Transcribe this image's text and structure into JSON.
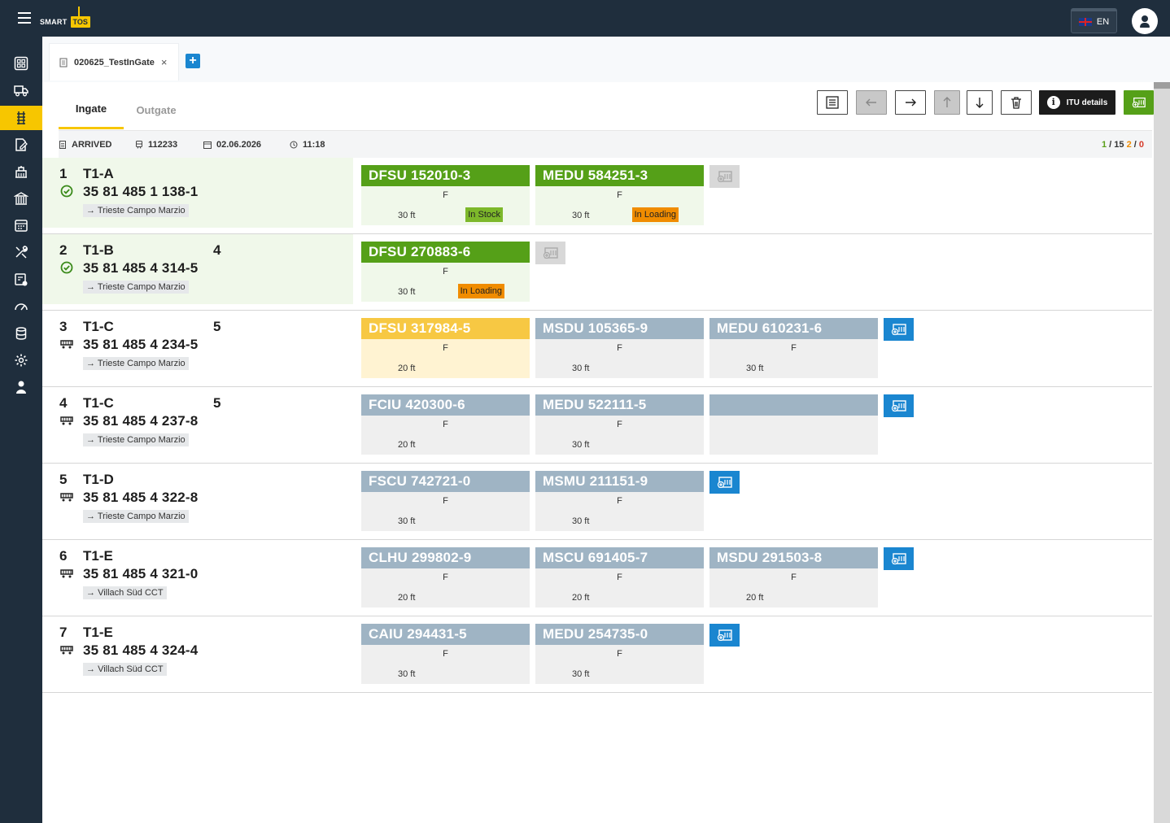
{
  "app": {
    "logo_text": "SMART",
    "logo_badge": "TOS",
    "language": "EN"
  },
  "tab": {
    "label": "020625_TestInGate",
    "close": "×",
    "add": "+"
  },
  "subtabs": [
    "Ingate",
    "Outgate"
  ],
  "toolbar": {
    "itu_details": "ITU details",
    "info": "i"
  },
  "info_row": {
    "status": "ARRIVED",
    "train_id": "112233",
    "date": "02.06.2026",
    "time": "11:18",
    "counter": {
      "a": "1",
      "sep1": "/",
      "b": "15",
      "c": "2",
      "sep2": "/",
      "d": "0"
    }
  },
  "colors": {
    "sidebar_bg": "#1f2e3d",
    "accent_yellow": "#f7c600",
    "green": "#55a018",
    "blue": "#1a86d0",
    "grey_card": "#9fb4c4",
    "orange": "#f08c00"
  },
  "wagons": [
    {
      "pos": "1",
      "type": "T1-A",
      "count": "",
      "number": "35 81 485 1 138-1",
      "destination": "Trieste Campo Marzio",
      "status_icon": "check-circle-icon",
      "containers": [
        {
          "id": "DFSU 152010-3",
          "fe": "F",
          "size": "30 ft",
          "status": "In Stock",
          "style": "green"
        },
        {
          "id": "MEDU 584251-3",
          "fe": "F",
          "size": "30 ft",
          "status": "In Loading",
          "style": "green"
        }
      ],
      "add_enabled": false
    },
    {
      "pos": "2",
      "type": "T1-B",
      "count": "4",
      "number": "35 81 485 4 314-5",
      "destination": "Trieste Campo Marzio",
      "status_icon": "check-circle-icon",
      "containers": [
        {
          "id": "DFSU 270883-6",
          "fe": "F",
          "size": "30 ft",
          "status": "In Loading",
          "style": "green"
        }
      ],
      "add_enabled": false
    },
    {
      "pos": "3",
      "type": "T1-C",
      "count": "5",
      "number": "35 81 485 4 234-5",
      "destination": "Trieste Campo Marzio",
      "status_icon": "wagon-icon",
      "containers": [
        {
          "id": "DFSU 317984-5",
          "fe": "F",
          "size": "20 ft",
          "status": "",
          "style": "yellow"
        },
        {
          "id": "MSDU 105365-9",
          "fe": "F",
          "size": "30 ft",
          "status": "",
          "style": "grey"
        },
        {
          "id": "MEDU 610231-6",
          "fe": "F",
          "size": "30 ft",
          "status": "",
          "style": "grey"
        }
      ],
      "add_enabled": true
    },
    {
      "pos": "4",
      "type": "T1-C",
      "count": "5",
      "number": "35 81 485 4 237-8",
      "destination": "Trieste Campo Marzio",
      "status_icon": "wagon-icon",
      "containers": [
        {
          "id": "FCIU 420300-6",
          "fe": "F",
          "size": "20 ft",
          "status": "",
          "style": "grey"
        },
        {
          "id": "MEDU 522111-5",
          "fe": "F",
          "size": "30 ft",
          "status": "",
          "style": "grey"
        },
        {
          "id": "",
          "fe": "",
          "size": "",
          "status": "",
          "style": "grey"
        }
      ],
      "add_enabled": true
    },
    {
      "pos": "5",
      "type": "T1-D",
      "count": "",
      "number": "35 81 485 4 322-8",
      "destination": "Trieste Campo Marzio",
      "status_icon": "wagon-icon",
      "containers": [
        {
          "id": "FSCU 742721-0",
          "fe": "F",
          "size": "30 ft",
          "status": "",
          "style": "grey"
        },
        {
          "id": "MSMU 211151-9",
          "fe": "F",
          "size": "30 ft",
          "status": "",
          "style": "grey"
        }
      ],
      "add_enabled": true
    },
    {
      "pos": "6",
      "type": "T1-E",
      "count": "",
      "number": "35 81 485 4 321-0",
      "destination": "Villach Süd CCT",
      "status_icon": "wagon-icon",
      "containers": [
        {
          "id": "CLHU 299802-9",
          "fe": "F",
          "size": "20 ft",
          "status": "",
          "style": "grey"
        },
        {
          "id": "MSCU 691405-7",
          "fe": "F",
          "size": "20 ft",
          "status": "",
          "style": "grey"
        },
        {
          "id": "MSDU 291503-8",
          "fe": "F",
          "size": "20 ft",
          "status": "",
          "style": "grey"
        }
      ],
      "add_enabled": true
    },
    {
      "pos": "7",
      "type": "T1-E",
      "count": "",
      "number": "35 81 485 4 324-4",
      "destination": "Villach Süd CCT",
      "status_icon": "wagon-icon",
      "containers": [
        {
          "id": "CAIU 294431-5",
          "fe": "F",
          "size": "30 ft",
          "status": "",
          "style": "grey"
        },
        {
          "id": "MEDU 254735-0",
          "fe": "F",
          "size": "30 ft",
          "status": "",
          "style": "grey"
        }
      ],
      "add_enabled": true
    }
  ]
}
